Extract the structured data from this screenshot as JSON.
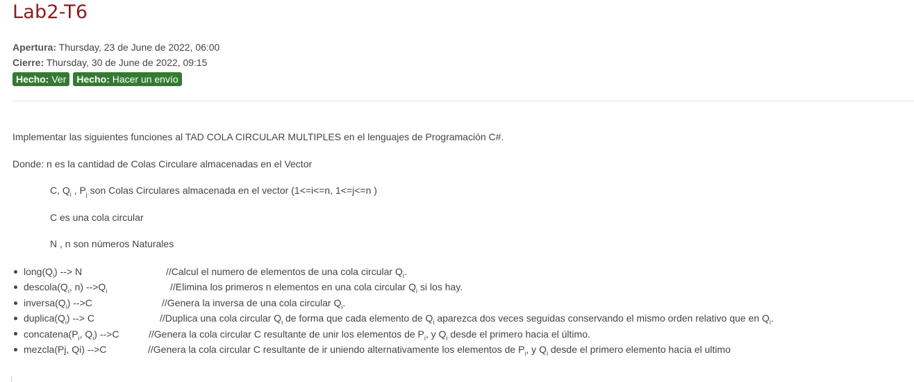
{
  "activity": {
    "title": "Lab2-T6",
    "opening_label": "Apertura:",
    "opening_value": "Thursday, 23 de June de 2022, 06:00",
    "closing_label": "Cierre:",
    "closing_value": "Thursday, 30 de June de 2022, 09:15",
    "badges": [
      {
        "label": "Hecho:",
        "value": "Ver"
      },
      {
        "label": "Hecho:",
        "value": "Hacer un envío"
      }
    ]
  },
  "description": {
    "intro": "Implementar las siguientes funciones al TAD COLA CIRCULAR MULTIPLES en el lenguajes de Programación C#.",
    "where": "Donde: n es la cantidad de Colas Circulare almacenadas en el Vector",
    "def_queues": {
      "a": "C,  Q",
      "b": " , P",
      "c": " son Colas Circulares almacenada en el vector  (1<=i<=n, 1<=j<=n )",
      "sub_i": "i",
      "sub_j": "j"
    },
    "def_c": "C es una cola circular",
    "def_n": "N , n son números Naturales"
  },
  "functions": {
    "sub_i": "i",
    "long": {
      "fn_a": "long(Q",
      "fn_b": ") --> N",
      "cm_a": "//Calcul el numero de elementos de una  cola circular Q",
      "cm_b": "."
    },
    "descola": {
      "fn_a": "descola(Q",
      "fn_b": ", n) -->Q",
      "cm_a": "//Elimina los primeros n elementos en una cola circular Q",
      "cm_b": " si los hay."
    },
    "inversa": {
      "fn_a": "inversa(Q",
      "fn_b": ")  -->C",
      "cm_a": "//Genera la inversa de una cola circular Q",
      "cm_b": "."
    },
    "duplica": {
      "fn_a": "duplica(Q",
      "fn_b": ")  --> C",
      "cm_a": "//Duplica una cola circular Q",
      "cm_b": " de forma que cada elemento de Q",
      "cm_c": " aparezca dos veces seguidas conservando el mismo orden relativo que en Q",
      "cm_d": "."
    },
    "concatena": {
      "fn_a": "concatena(P",
      "fn_b": ", Q",
      "fn_c": ") -->C",
      "cm_a": "//Genera la cola circular C resultante de unir los elementos de P",
      "cm_b": ", y Q",
      "cm_c": " desde el primero hacia el último."
    },
    "mezcla": {
      "fn": "mezcla(Pj, Qi) -->C",
      "cm_a": "//Genera la cola circular C resultante de ir uniendo  alternativamente los elementos de P",
      "cm_b": ", y Q",
      "cm_c": " desde el primero elemento hacia el ultimo"
    }
  }
}
